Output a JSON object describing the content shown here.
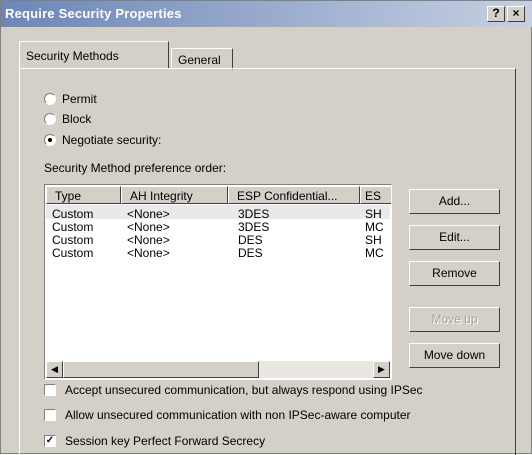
{
  "window": {
    "title": "Require Security Properties",
    "help_label": "?",
    "close_label": "×"
  },
  "tabs": [
    {
      "label": "Security Methods"
    },
    {
      "label": "General"
    }
  ],
  "radios": [
    {
      "label": "Permit",
      "checked": false
    },
    {
      "label": "Block",
      "checked": false
    },
    {
      "label": "Negotiate security:",
      "checked": true
    }
  ],
  "list_label": "Security Method preference order:",
  "table": {
    "columns": [
      "Type",
      "AH Integrity",
      "ESP Confidential...",
      "ES"
    ],
    "rows": [
      [
        "Custom",
        "<None>",
        "3DES",
        "SH"
      ],
      [
        "Custom",
        "<None>",
        "3DES",
        "MC"
      ],
      [
        "Custom",
        "<None>",
        "DES",
        "SH"
      ],
      [
        "Custom",
        "<None>",
        "DES",
        "MC"
      ]
    ]
  },
  "buttons": {
    "add": "Add...",
    "edit": "Edit...",
    "remove": "Remove",
    "move_up": "Move up",
    "move_down": "Move down"
  },
  "scroll": {
    "left_icon": "◀",
    "right_icon": "▶"
  },
  "checks": [
    {
      "label": "Accept unsecured communication, but always respond using IPSec",
      "checked": false
    },
    {
      "label": "Allow unsecured communication with non IPSec-aware computer",
      "checked": false
    },
    {
      "label": "Session key Perfect Forward Secrecy",
      "checked": true
    }
  ]
}
